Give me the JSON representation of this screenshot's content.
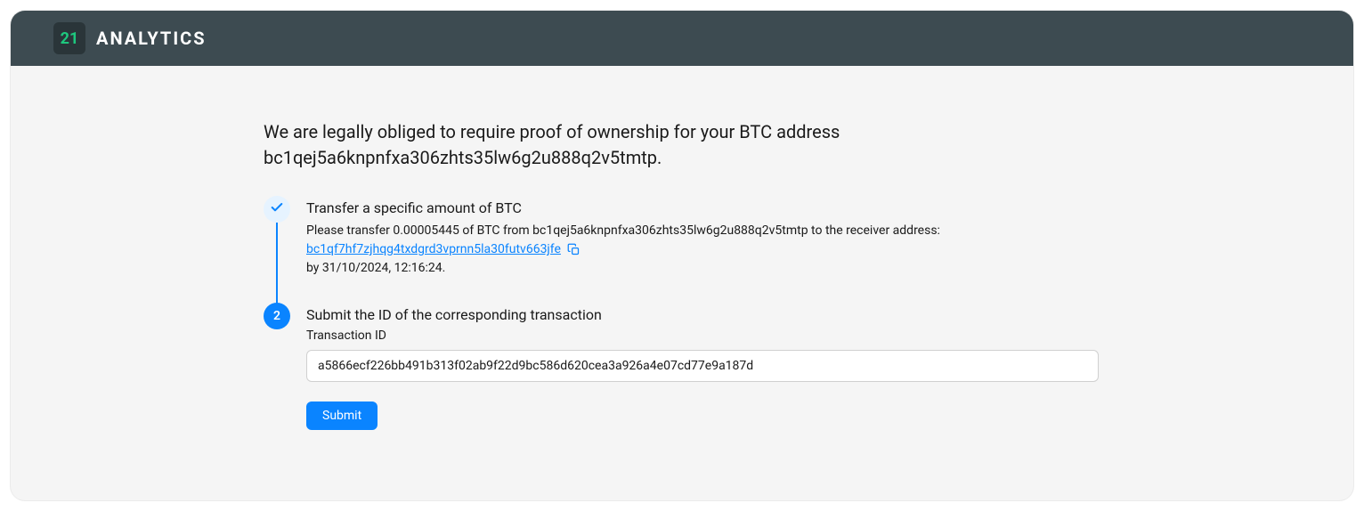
{
  "brand": {
    "badge": "21",
    "name": "ANALYTICS"
  },
  "intro": {
    "line1": "We are legally obliged to require proof of ownership for your BTC address",
    "line2": "bc1qej5a6knpnfxa306zhts35lw6g2u888q2v5tmtp."
  },
  "steps": {
    "step1": {
      "title": "Transfer a specific amount of BTC",
      "desc_prefix": "Please transfer 0.00005445 of BTC from bc1qej5a6knpnfxa306zhts35lw6g2u888q2v5tmtp to the receiver address:",
      "receiver_address": "bc1qf7hf7zjhqg4txdgrd3vprnn5la30futv663jfe",
      "deadline": "by 31/10/2024, 12:16:24."
    },
    "step2": {
      "number": "2",
      "title": "Submit the ID of the corresponding transaction",
      "field_label": "Transaction ID",
      "input_value": "a5866ecf226bb491b313f02ab9f22d9bc586d620cea3a926a4e07cd77e9a187d",
      "submit_label": "Submit"
    }
  }
}
